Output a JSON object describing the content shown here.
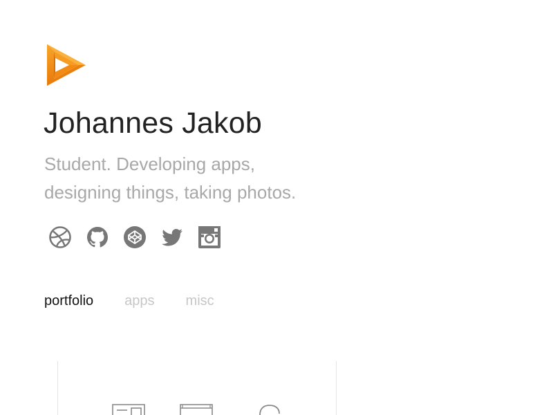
{
  "header": {
    "logo_icon": "orange-play-triangle-logo",
    "title": "Johannes Jakob",
    "tagline_line1": "Student. Developing apps,",
    "tagline_line2": "designing things, taking photos."
  },
  "social": [
    {
      "icon": "dribbble-icon"
    },
    {
      "icon": "github-icon"
    },
    {
      "icon": "codepen-icon"
    },
    {
      "icon": "twitter-icon"
    },
    {
      "icon": "instagram-icon"
    }
  ],
  "tabs": [
    {
      "label": "portfolio",
      "active": true
    },
    {
      "label": "apps",
      "active": false
    },
    {
      "label": "misc",
      "active": false
    }
  ],
  "colors": {
    "accent": "#f39a1e",
    "accent_dark": "#e27d0c",
    "icon": "#777777",
    "muted_text": "#a8a8a8",
    "inactive_tab": "#c6c6c6"
  }
}
